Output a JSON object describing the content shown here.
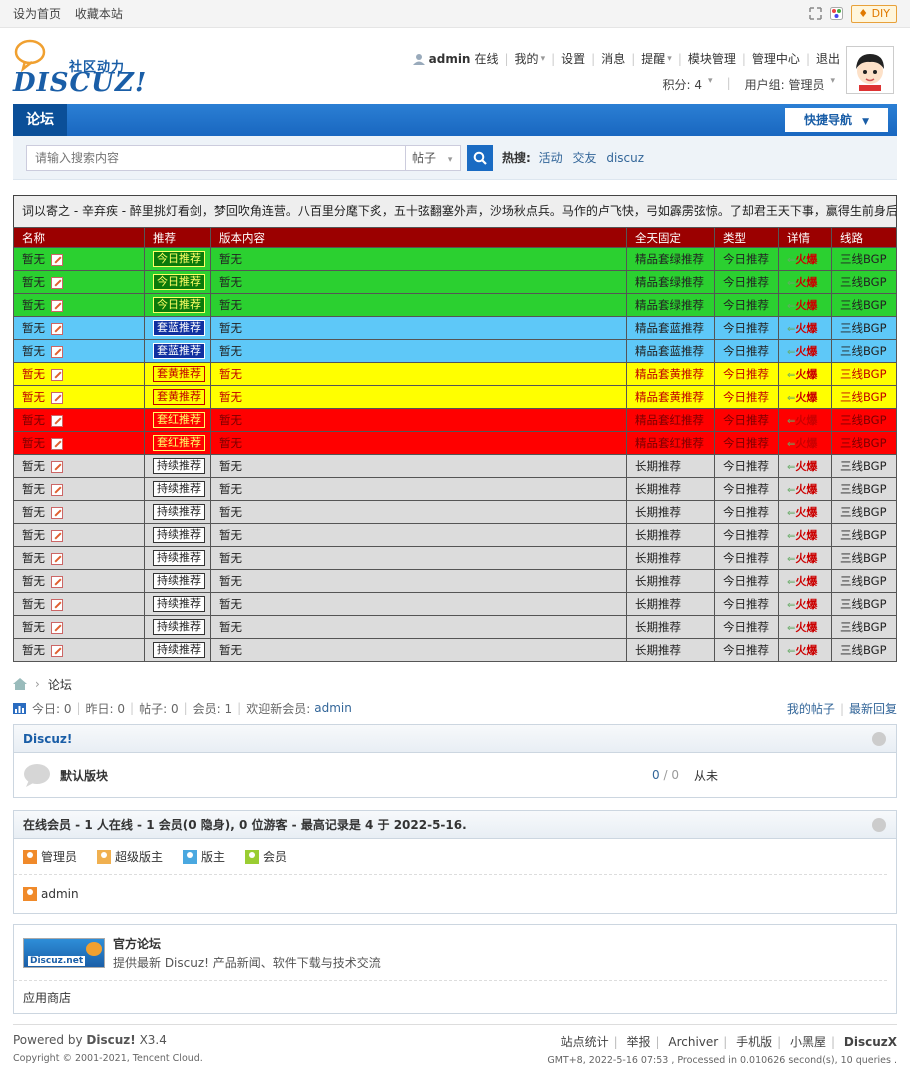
{
  "topbar": {
    "set_home": "设为首页",
    "favorite": "收藏本站",
    "diy": "DIY"
  },
  "logo": {
    "brand": "DISCUZ!",
    "slogan": "社区动力"
  },
  "user": {
    "name": "admin",
    "status": "在线",
    "menu": [
      "我的",
      "设置",
      "消息",
      "提醒",
      "模块管理",
      "管理中心",
      "退出"
    ],
    "credits": "积分: 4",
    "group": "用户组: 管理员"
  },
  "nav": {
    "forum": "论坛",
    "quick_nav": "快捷导航"
  },
  "search": {
    "placeholder": "请输入搜索内容",
    "type": "帖子",
    "hot_label": "热搜:",
    "hot_words": [
      "活动",
      "交友",
      "discuz"
    ]
  },
  "marquee": "词以寄之 - 辛弃疾 - 醉里挑灯看剑，梦回吹角连营。八百里分麾下炙，五十弦翻塞外声，沙场秋点兵。马作的卢飞快，弓如霹雳弦惊。了却君王天下事，赢得生前身后名。可怜白发生！",
  "ad_table": {
    "headers": [
      "名称",
      "推荐",
      "版本内容",
      "全天固定",
      "类型",
      "详情",
      "线路"
    ],
    "rows": [
      {
        "name": "暂无",
        "tag": "今日推荐",
        "content": "暂无",
        "fixed": "精品套绿推荐",
        "type": "今日推荐",
        "detail": "火爆",
        "line": "三线BGP",
        "bg": "#2bd030",
        "fg": "#222",
        "tag_bg": "#0a7a0a",
        "tag_fg": "#ffff66"
      },
      {
        "name": "暂无",
        "tag": "今日推荐",
        "content": "暂无",
        "fixed": "精品套绿推荐",
        "type": "今日推荐",
        "detail": "火爆",
        "line": "三线BGP",
        "bg": "#2bd030",
        "fg": "#222",
        "tag_bg": "#0a7a0a",
        "tag_fg": "#ffff66"
      },
      {
        "name": "暂无",
        "tag": "今日推荐",
        "content": "暂无",
        "fixed": "精品套绿推荐",
        "type": "今日推荐",
        "detail": "火爆",
        "line": "三线BGP",
        "bg": "#2bd030",
        "fg": "#222",
        "tag_bg": "#0a7a0a",
        "tag_fg": "#ffff66"
      },
      {
        "name": "暂无",
        "tag": "套蓝推荐",
        "content": "暂无",
        "fixed": "精品套蓝推荐",
        "type": "今日推荐",
        "detail": "火爆",
        "line": "三线BGP",
        "bg": "#5ec8f8",
        "fg": "#222",
        "tag_bg": "#1030a0",
        "tag_fg": "#ffffff"
      },
      {
        "name": "暂无",
        "tag": "套蓝推荐",
        "content": "暂无",
        "fixed": "精品套蓝推荐",
        "type": "今日推荐",
        "detail": "火爆",
        "line": "三线BGP",
        "bg": "#5ec8f8",
        "fg": "#222",
        "tag_bg": "#1030a0",
        "tag_fg": "#ffffff"
      },
      {
        "name": "暂无",
        "tag": "套黄推荐",
        "content": "暂无",
        "fixed": "精品套黄推荐",
        "type": "今日推荐",
        "detail": "火爆",
        "line": "三线BGP",
        "bg": "#ffff00",
        "fg": "#c00000",
        "tag_bg": "#ffff00",
        "tag_fg": "#c00000"
      },
      {
        "name": "暂无",
        "tag": "套黄推荐",
        "content": "暂无",
        "fixed": "精品套黄推荐",
        "type": "今日推荐",
        "detail": "火爆",
        "line": "三线BGP",
        "bg": "#ffff00",
        "fg": "#c00000",
        "tag_bg": "#ffff00",
        "tag_fg": "#c00000"
      },
      {
        "name": "暂无",
        "tag": "套红推荐",
        "content": "暂无",
        "fixed": "精品套红推荐",
        "type": "今日推荐",
        "detail": "火爆",
        "line": "三线BGP",
        "bg": "#ff0000",
        "fg": "#7a0000",
        "tag_bg": "#ff0000",
        "tag_fg": "#ffff66"
      },
      {
        "name": "暂无",
        "tag": "套红推荐",
        "content": "暂无",
        "fixed": "精品套红推荐",
        "type": "今日推荐",
        "detail": "火爆",
        "line": "三线BGP",
        "bg": "#ff0000",
        "fg": "#7a0000",
        "tag_bg": "#ff0000",
        "tag_fg": "#ffff66"
      },
      {
        "name": "暂无",
        "tag": "持续推荐",
        "content": "暂无",
        "fixed": "长期推荐",
        "type": "今日推荐",
        "detail": "火爆",
        "line": "三线BGP",
        "bg": "#dcdcdc",
        "fg": "#222",
        "tag_bg": "#ffffff",
        "tag_fg": "#222"
      },
      {
        "name": "暂无",
        "tag": "持续推荐",
        "content": "暂无",
        "fixed": "长期推荐",
        "type": "今日推荐",
        "detail": "火爆",
        "line": "三线BGP",
        "bg": "#dcdcdc",
        "fg": "#222",
        "tag_bg": "#ffffff",
        "tag_fg": "#222"
      },
      {
        "name": "暂无",
        "tag": "持续推荐",
        "content": "暂无",
        "fixed": "长期推荐",
        "type": "今日推荐",
        "detail": "火爆",
        "line": "三线BGP",
        "bg": "#dcdcdc",
        "fg": "#222",
        "tag_bg": "#ffffff",
        "tag_fg": "#222"
      },
      {
        "name": "暂无",
        "tag": "持续推荐",
        "content": "暂无",
        "fixed": "长期推荐",
        "type": "今日推荐",
        "detail": "火爆",
        "line": "三线BGP",
        "bg": "#dcdcdc",
        "fg": "#222",
        "tag_bg": "#ffffff",
        "tag_fg": "#222"
      },
      {
        "name": "暂无",
        "tag": "持续推荐",
        "content": "暂无",
        "fixed": "长期推荐",
        "type": "今日推荐",
        "detail": "火爆",
        "line": "三线BGP",
        "bg": "#dcdcdc",
        "fg": "#222",
        "tag_bg": "#ffffff",
        "tag_fg": "#222"
      },
      {
        "name": "暂无",
        "tag": "持续推荐",
        "content": "暂无",
        "fixed": "长期推荐",
        "type": "今日推荐",
        "detail": "火爆",
        "line": "三线BGP",
        "bg": "#dcdcdc",
        "fg": "#222",
        "tag_bg": "#ffffff",
        "tag_fg": "#222"
      },
      {
        "name": "暂无",
        "tag": "持续推荐",
        "content": "暂无",
        "fixed": "长期推荐",
        "type": "今日推荐",
        "detail": "火爆",
        "line": "三线BGP",
        "bg": "#dcdcdc",
        "fg": "#222",
        "tag_bg": "#ffffff",
        "tag_fg": "#222"
      },
      {
        "name": "暂无",
        "tag": "持续推荐",
        "content": "暂无",
        "fixed": "长期推荐",
        "type": "今日推荐",
        "detail": "火爆",
        "line": "三线BGP",
        "bg": "#dcdcdc",
        "fg": "#222",
        "tag_bg": "#ffffff",
        "tag_fg": "#222"
      },
      {
        "name": "暂无",
        "tag": "持续推荐",
        "content": "暂无",
        "fixed": "长期推荐",
        "type": "今日推荐",
        "detail": "火爆",
        "line": "三线BGP",
        "bg": "#dcdcdc",
        "fg": "#222",
        "tag_bg": "#ffffff",
        "tag_fg": "#222"
      }
    ]
  },
  "breadcrumb": {
    "current": "论坛"
  },
  "stats": {
    "today": "今日: 0",
    "yesterday": "昨日: 0",
    "posts": "帖子: 0",
    "members": "会员: 1",
    "welcome": "欢迎新会员:",
    "newest": "admin",
    "my_posts": "我的帖子",
    "latest": "最新回复"
  },
  "category": {
    "title": "Discuz!",
    "board": "默认版块",
    "count_a": "0",
    "count_b": "0",
    "last": "从未"
  },
  "online": {
    "title": "在线会员 - 1 人在线 - 1 会员(0 隐身), 0 位游客 - 最高记录是 4 于 2022-5-16.",
    "legend": [
      {
        "label": "管理员",
        "color": "#f08a2a"
      },
      {
        "label": "超级版主",
        "color": "#f0b050"
      },
      {
        "label": "版主",
        "color": "#4aa8e0"
      },
      {
        "label": "会员",
        "color": "#9acd32"
      }
    ],
    "users": [
      "admin"
    ]
  },
  "links": {
    "official_title": "官方论坛",
    "official_desc": "提供最新 Discuz! 产品新闻、软件下载与技术交流",
    "logo_text": "Discuz.net",
    "app_store": "应用商店"
  },
  "footer": {
    "powered_pre": "Powered by",
    "powered": "Discuz!",
    "version": "X3.4",
    "copyright": "Copyright © 2001-2021, Tencent Cloud.",
    "links": [
      "站点统计",
      "举报",
      "Archiver",
      "手机版",
      "小黑屋"
    ],
    "brand": "DiscuzX",
    "debug": "GMT+8, 2022-5-16 07:53 , Processed in 0.010626 second(s), 10 queries ."
  },
  "colors": {
    "header_red": "#9b0000",
    "nav_blue": "#1967c0",
    "link_blue": "#336699"
  }
}
